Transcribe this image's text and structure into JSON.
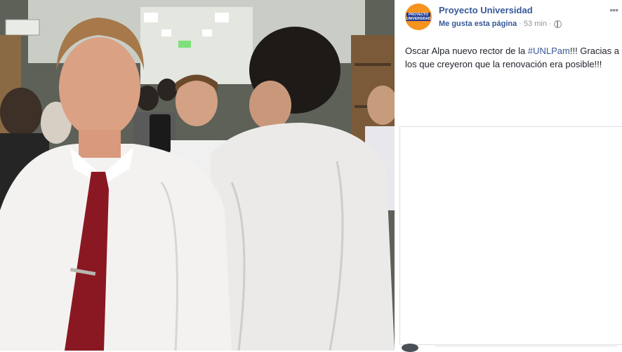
{
  "post": {
    "page_name": "Proyecto Universidad",
    "like_link": "Me gusta esta página",
    "separator": "·",
    "timestamp": "53 min",
    "separator2": "·",
    "more_icon": "more-horizontal-icon",
    "text_before": "Oscar Alpa nuevo rector de la ",
    "hashtag": "#UNLPam",
    "text_after": "!!! Gracias a los que creyeron que la renovación era posible!!!",
    "avatar_logo_text": "Proyecto Universidad"
  },
  "colors": {
    "link": "#365899",
    "meta": "#90949c",
    "avatar_bg": "#f6921e",
    "text": "#1d2129"
  },
  "photo": {
    "icon": "photo-image"
  }
}
